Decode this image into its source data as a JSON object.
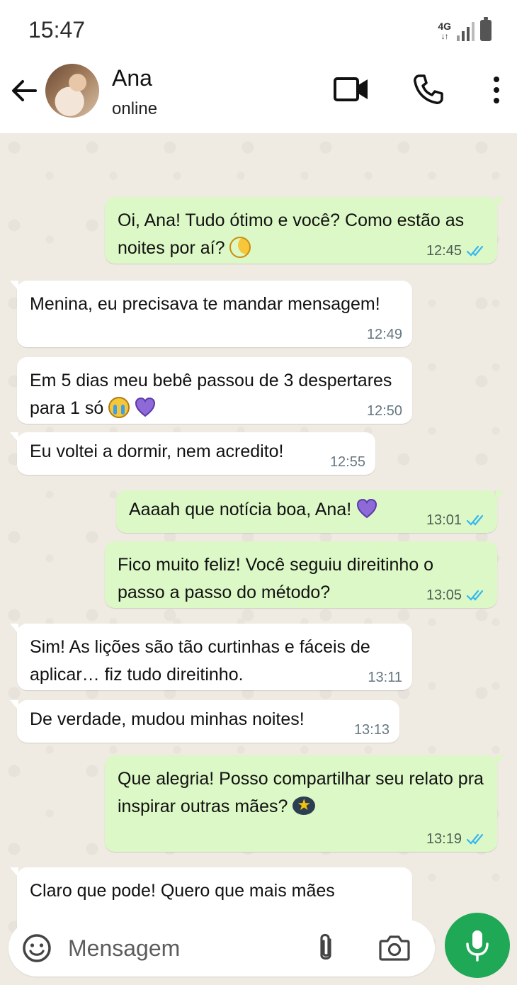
{
  "status_bar": {
    "time": "15:47",
    "network": "4G",
    "network_arrows": "↓↑"
  },
  "header": {
    "back_icon": "arrow-back-icon",
    "contact_name": "Ana",
    "contact_status": "online",
    "actions": [
      "video-call-icon",
      "voice-call-icon",
      "more-vertical-icon"
    ]
  },
  "messages": [
    {
      "direction": "out",
      "text": "Oi, Ana! Tudo ótimo e você? Como estão as noites por aí?",
      "emoji": "crescent-moon",
      "time": "12:45",
      "read": true
    },
    {
      "direction": "in",
      "text": "Menina, eu precisava te mandar mensagem!",
      "time": "12:49"
    },
    {
      "direction": "in",
      "text": "Em 5 dias meu bebê passou de 3 despertares para 1 só",
      "emoji": [
        "loudly-crying-face",
        "purple-heart"
      ],
      "time": "12:50"
    },
    {
      "direction": "in",
      "text": "Eu voltei a dormir, nem acredito!",
      "time": "12:55"
    },
    {
      "direction": "out",
      "text": "Aaaah que notícia boa, Ana!",
      "emoji": "purple-heart",
      "time": "13:01",
      "read": true
    },
    {
      "direction": "out",
      "text": "Fico muito feliz! Você seguiu direitinho o passo a passo do método?",
      "time": "13:05",
      "read": true
    },
    {
      "direction": "in",
      "text": "Sim! As lições são tão curtinhas e fáceis de aplicar… fiz tudo direitinho.",
      "time": "13:11"
    },
    {
      "direction": "in",
      "text": "De verdade, mudou minhas noites!",
      "time": "13:13"
    },
    {
      "direction": "out",
      "text": "Que alegria! Posso compartilhar seu relato pra inspirar outras mães?",
      "emoji": "star-struck",
      "time": "13:19",
      "read": true
    },
    {
      "direction": "in",
      "text": "Claro que pode! Quero que mais mães",
      "partial": true
    }
  ],
  "input_bar": {
    "placeholder": "Mensagem",
    "icons": [
      "smiley-icon",
      "paperclip-icon",
      "camera-icon"
    ]
  },
  "mic_button": {
    "icon": "microphone-icon"
  },
  "colors": {
    "outgoing_bubble": "#dcf8c6",
    "incoming_bubble": "#ffffff",
    "chat_background": "#efeae2",
    "read_ticks": "#34b7f1",
    "mic_button": "#1fa855"
  }
}
